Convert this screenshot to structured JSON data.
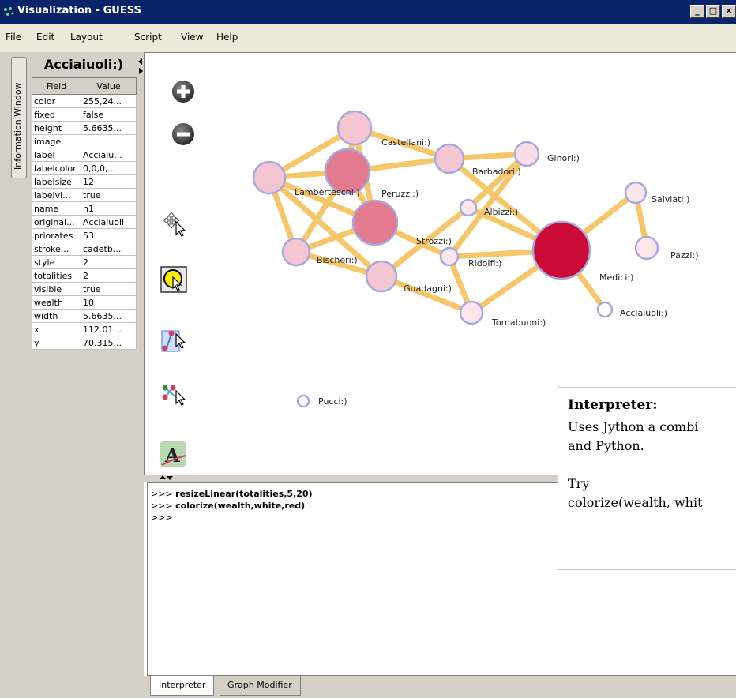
{
  "window": {
    "title": "Visualization - GUESS",
    "controls": [
      "_",
      "□",
      "×"
    ]
  },
  "menu": [
    "File",
    "Edit",
    "Layout",
    "Script",
    "View",
    "Help"
  ],
  "sidebar_tab": "Information Window",
  "info_panel": {
    "title": "Acciaiuoli:)",
    "columns": [
      "Field",
      "Value"
    ],
    "rows": [
      [
        "color",
        "255,24..."
      ],
      [
        "fixed",
        "false"
      ],
      [
        "height",
        "5.6635..."
      ],
      [
        "image",
        ""
      ],
      [
        "label",
        "Acciaiu..."
      ],
      [
        "labelcolor",
        "0,0,0,..."
      ],
      [
        "labelsize",
        "12"
      ],
      [
        "labelvi...",
        "true"
      ],
      [
        "name",
        "n1"
      ],
      [
        "original...",
        "Acciaiuoli"
      ],
      [
        "priorates",
        "53"
      ],
      [
        "stroke...",
        "cadetb..."
      ],
      [
        "style",
        "2"
      ],
      [
        "totalities",
        "2"
      ],
      [
        "visible",
        "true"
      ],
      [
        "wealth",
        "10"
      ],
      [
        "width",
        "5.6635..."
      ],
      [
        "x",
        "112.01..."
      ],
      [
        "y",
        "70.315..."
      ]
    ]
  },
  "toolbar_icons": [
    "zoom-in-icon",
    "zoom-out-icon",
    "move-tool-icon",
    "select-tool-icon",
    "edge-tool-icon",
    "node-edit-tool-icon",
    "text-tool-icon"
  ],
  "graph": {
    "edge_color": "#f5c66a",
    "node_stroke": "#a8a8e0",
    "node_labels": {
      "castellani": "Castellani:)",
      "barbadori": "Barbadori:)",
      "ginori": "Ginori:)",
      "lamberteschi": "Lamberteschi:)",
      "peruzzi": "Peruzzi:)",
      "salviati": "Salviati:)",
      "albizzi": "Albizzi:)",
      "strozzi": "Strozzi:)",
      "ridolfi": "Ridolfi:)",
      "bischeri": "Bischeri:)",
      "pazzi": "Pazzi:)",
      "guadagni": "Guadagni:)",
      "medici": "Medici:)",
      "acciaiuoli": "Acciaiuoli:)",
      "tornabuoni": "Tornabuoni:)",
      "pucci": "Pucci:)"
    }
  },
  "console": {
    "lines": [
      {
        "prompt": ">>>",
        "cmd": "resizeLinear(totalities,5,20)"
      },
      {
        "prompt": ">>>",
        "cmd": "colorize(wealth,white,red)"
      },
      {
        "prompt": ">>>",
        "cmd": ""
      }
    ]
  },
  "tabs": [
    "Interpreter",
    "Graph Modifier"
  ],
  "callout": {
    "title": "Interpreter:",
    "line1": "Uses Jython a combi",
    "line2": "and Python.",
    "line3": "Try",
    "line4": "colorize(wealth, whit"
  }
}
